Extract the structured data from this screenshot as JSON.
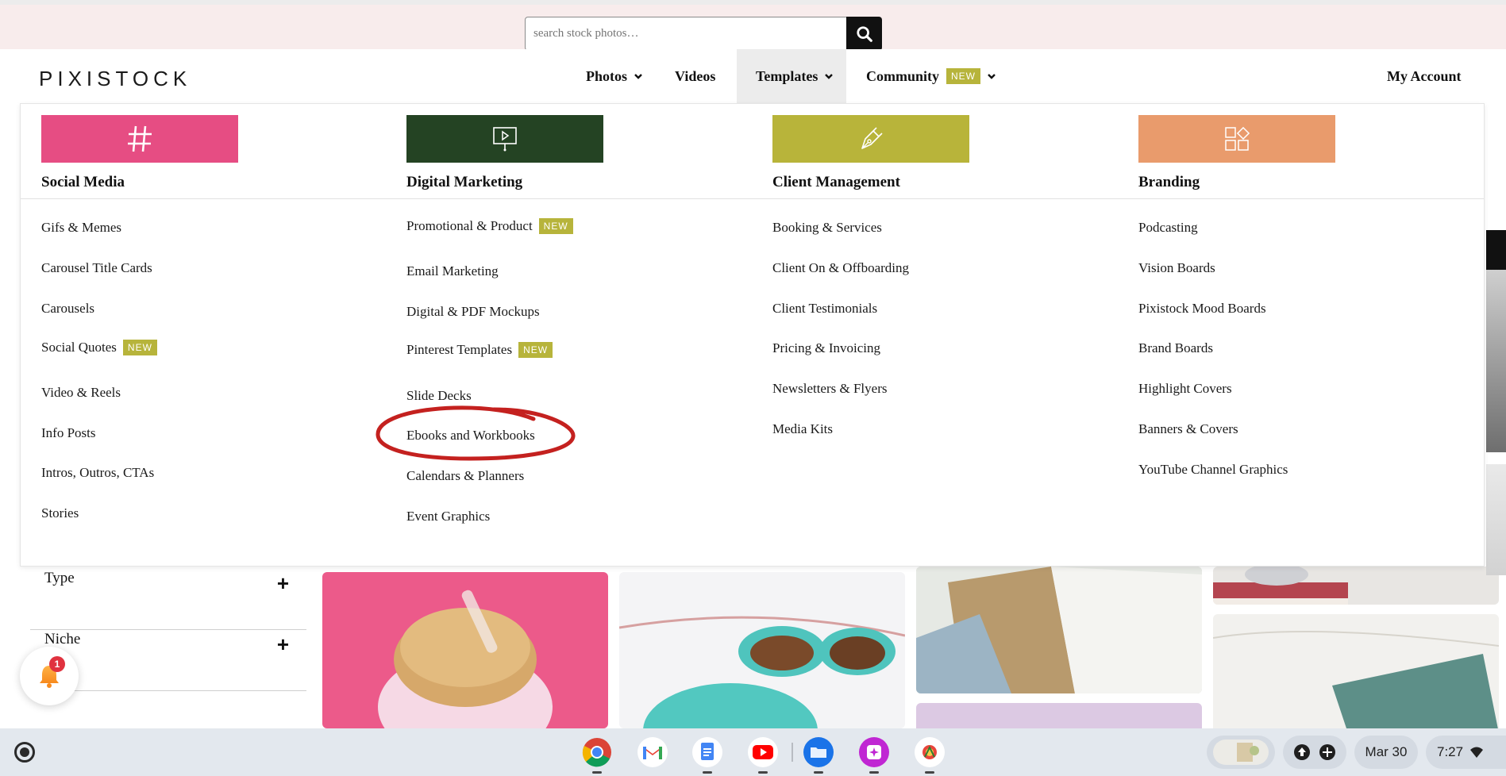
{
  "search": {
    "placeholder": "search stock photos…"
  },
  "brand": {
    "logo": "PIXISTOCK"
  },
  "nav": {
    "photos": "Photos",
    "videos": "Videos",
    "templates": "Templates",
    "community": "Community",
    "new_badge": "NEW",
    "account": "My Account"
  },
  "mega_menu": {
    "columns": [
      {
        "title": "Social Media",
        "tile_color": "#e64d83",
        "icon": "hashtag-icon",
        "items": [
          {
            "label": "Gifs & Memes",
            "badge": ""
          },
          {
            "label": "Carousel Title Cards",
            "badge": ""
          },
          {
            "label": "Carousels",
            "badge": ""
          },
          {
            "label": "Social Quotes",
            "badge": "NEW"
          },
          {
            "label": "Video & Reels",
            "badge": ""
          },
          {
            "label": "Info Posts",
            "badge": ""
          },
          {
            "label": "Intros, Outros, CTAs",
            "badge": ""
          },
          {
            "label": "Stories",
            "badge": ""
          }
        ]
      },
      {
        "title": "Digital Marketing",
        "tile_color": "#244323",
        "icon": "presentation-icon",
        "items": [
          {
            "label": "Promotional & Product",
            "badge": "NEW"
          },
          {
            "label": "Email Marketing",
            "badge": ""
          },
          {
            "label": "Digital & PDF Mockups",
            "badge": ""
          },
          {
            "label": "Pinterest Templates",
            "badge": "NEW"
          },
          {
            "label": "Slide Decks",
            "badge": ""
          },
          {
            "label": "Ebooks and Workbooks",
            "badge": ""
          },
          {
            "label": "Calendars & Planners",
            "badge": ""
          },
          {
            "label": "Event Graphics",
            "badge": ""
          }
        ]
      },
      {
        "title": "Client Management",
        "tile_color": "#b8b43a",
        "icon": "pen-nib-icon",
        "items": [
          {
            "label": "Booking & Services",
            "badge": ""
          },
          {
            "label": "Client On & Offboarding",
            "badge": ""
          },
          {
            "label": "Client Testimonials",
            "badge": ""
          },
          {
            "label": "Pricing & Invoicing",
            "badge": ""
          },
          {
            "label": "Newsletters & Flyers",
            "badge": ""
          },
          {
            "label": "Media Kits",
            "badge": ""
          }
        ]
      },
      {
        "title": "Branding",
        "tile_color": "#e99b6c",
        "icon": "shapes-icon",
        "items": [
          {
            "label": "Podcasting",
            "badge": ""
          },
          {
            "label": "Vision Boards",
            "badge": ""
          },
          {
            "label": "Pixistock Mood Boards",
            "badge": ""
          },
          {
            "label": "Brand Boards",
            "badge": ""
          },
          {
            "label": "Highlight Covers",
            "badge": ""
          },
          {
            "label": "Banners & Covers",
            "badge": ""
          },
          {
            "label": "YouTube Channel Graphics",
            "badge": ""
          }
        ]
      }
    ]
  },
  "filters": [
    {
      "label": "Type"
    },
    {
      "label": "Niche"
    }
  ],
  "notifications": {
    "count": "1"
  },
  "taskbar": {
    "apps": [
      "chrome-icon",
      "gmail-icon",
      "docs-icon",
      "youtube-icon",
      "files-icon",
      "gallery-icon",
      "extension-icon"
    ],
    "date": "Mar 30",
    "time": "7:27"
  }
}
